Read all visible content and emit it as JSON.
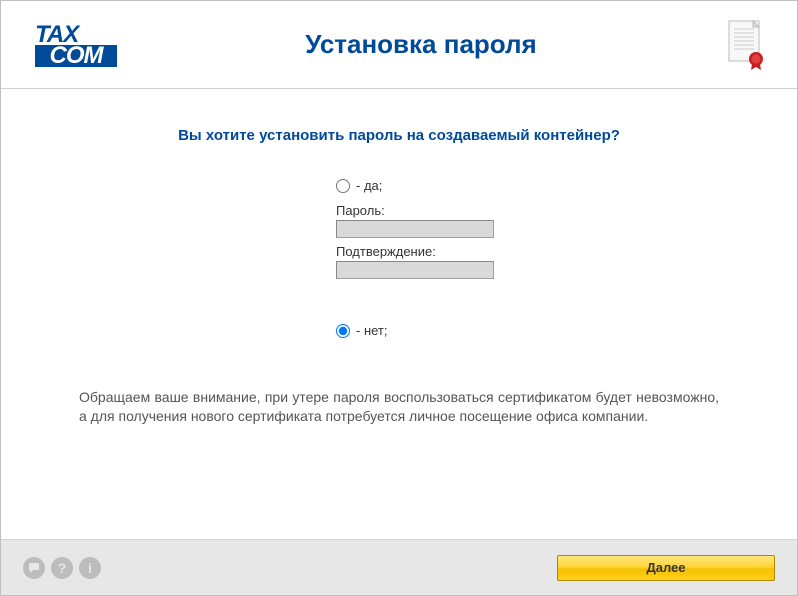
{
  "logo": {
    "top": "TAX",
    "bottom": "COM"
  },
  "header": {
    "title": "Установка пароля"
  },
  "content": {
    "question": "Вы хотите установить пароль на создаваемый контейнер?",
    "option_yes": " - да;",
    "option_no": " - нет;",
    "password_label": "Пароль:",
    "confirm_label": "Подтверждение:",
    "password_value": "",
    "confirm_value": "",
    "selected": "no",
    "notice": "Обращаем ваше внимание, при утере пароля воспользоваться сертификатом будет невозможно, а для получения нового сертификата потребуется личное посещение офиса компании."
  },
  "footer": {
    "next_label": "Далее"
  }
}
